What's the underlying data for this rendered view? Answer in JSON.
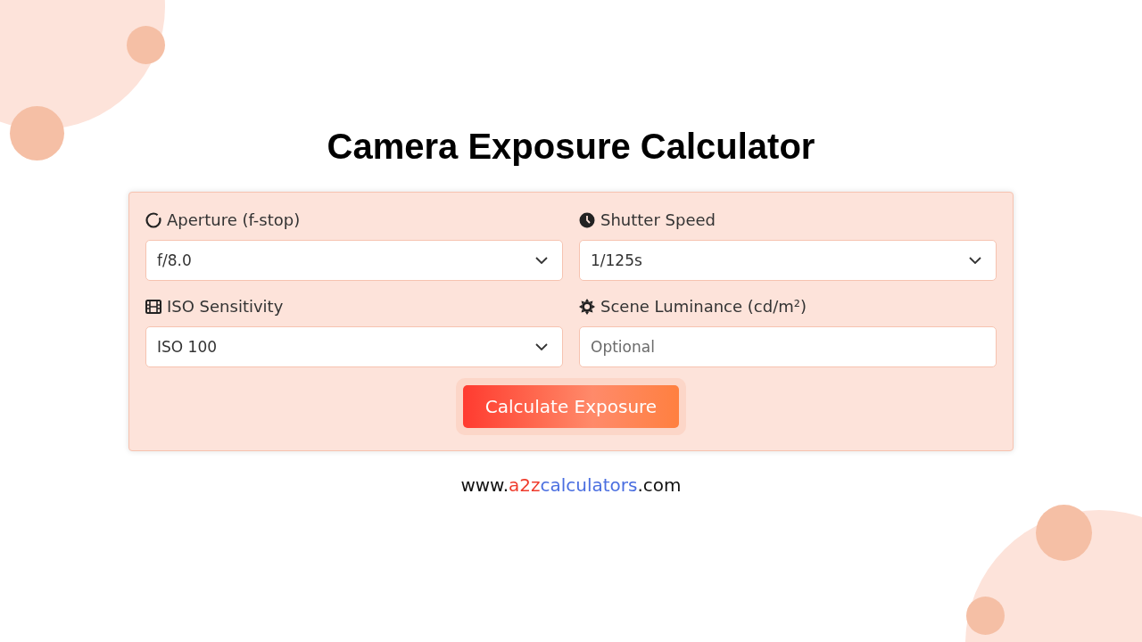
{
  "title": "Camera Exposure Calculator",
  "fields": [
    {
      "kind": "select",
      "label": "Aperture (f-stop)",
      "value": "f/8.0"
    },
    {
      "kind": "select",
      "label": "Shutter Speed",
      "value": "1/125s"
    },
    {
      "kind": "select",
      "label": "ISO Sensitivity",
      "value": "ISO 100"
    },
    {
      "kind": "input",
      "label": "Scene Luminance (cd/m²)",
      "placeholder": "Optional"
    }
  ],
  "button": {
    "label": "Calculate Exposure"
  },
  "website": [
    {
      "text": "www.",
      "color": "#111111"
    },
    {
      "text": "a2z",
      "color": "#ef3b2c"
    },
    {
      "text": "calculators",
      "color": "#4a6ee0"
    },
    {
      "text": ".com",
      "color": "#111111"
    }
  ]
}
